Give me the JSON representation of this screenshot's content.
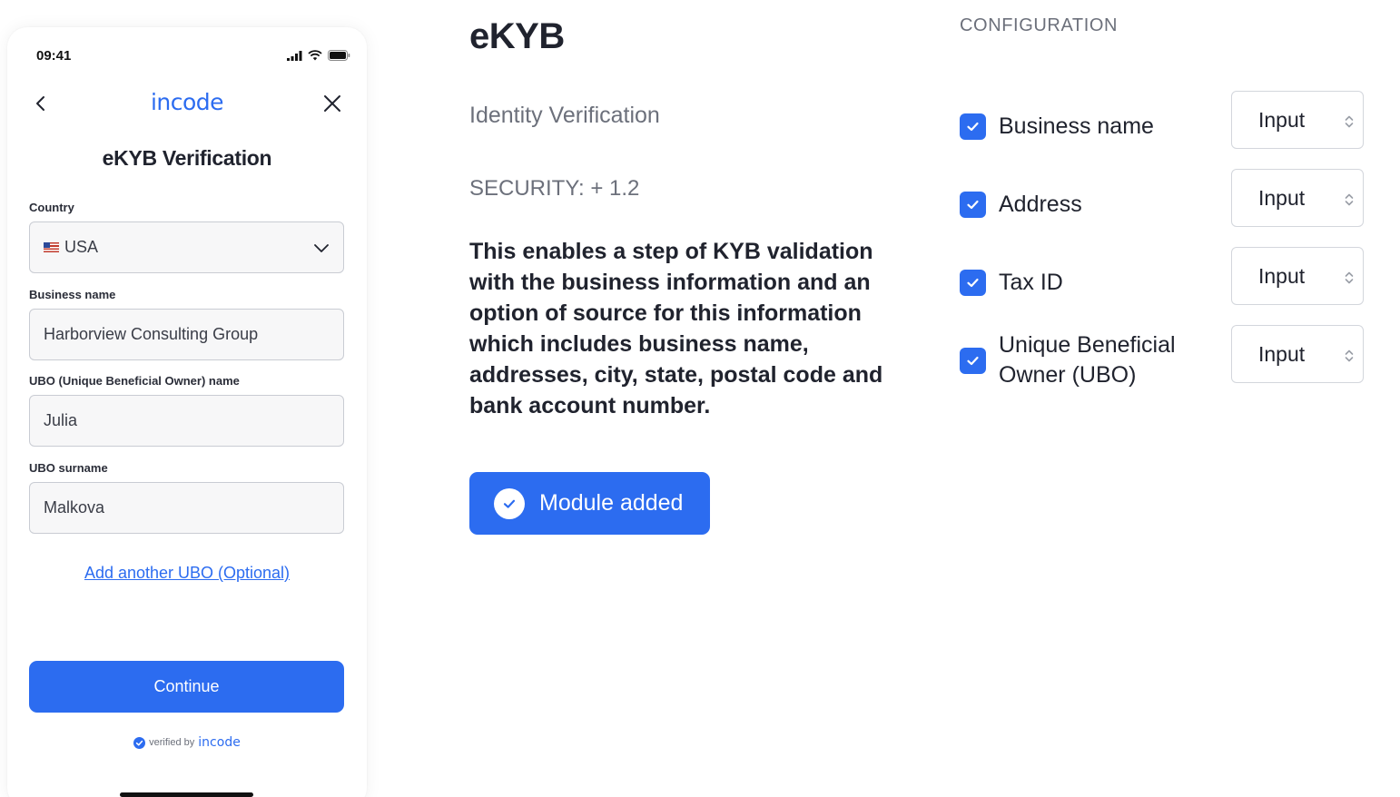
{
  "phone": {
    "status_time": "09:41",
    "brand": "incode",
    "title": "eKYB Verification",
    "fields": [
      {
        "label": "Country",
        "value": "USA"
      },
      {
        "label": "Business name",
        "value": "Harborview Consulting Group"
      },
      {
        "label": "UBO (Unique Beneficial Owner) name",
        "value": "Julia"
      },
      {
        "label": "UBO surname",
        "value": "Malkova"
      }
    ],
    "add_link": "Add another UBO (Optional)",
    "continue_label": "Continue",
    "verified_text": "verified by",
    "verified_brand": "incode"
  },
  "module": {
    "title": "eKYB",
    "subtitle": "Identity Verification",
    "security": "SECURITY: + 1.2",
    "description": "This enables a step of KYB validation with the business information and an option of source for this information which includes business name, addresses, city, state, postal code and bank account number.",
    "button_label": "Module added"
  },
  "configuration": {
    "title": "CONFIGURATION",
    "items": [
      {
        "label": "Business name",
        "checked": true,
        "source": "Input"
      },
      {
        "label": "Address",
        "checked": true,
        "source": "Input"
      },
      {
        "label": "Tax ID",
        "checked": true,
        "source": "Input"
      },
      {
        "label": "Unique Beneficial Owner (UBO)",
        "checked": true,
        "source": "Input"
      }
    ]
  },
  "colors": {
    "accent": "#2c6cf0",
    "text": "#20232e",
    "muted": "#6c707b"
  }
}
